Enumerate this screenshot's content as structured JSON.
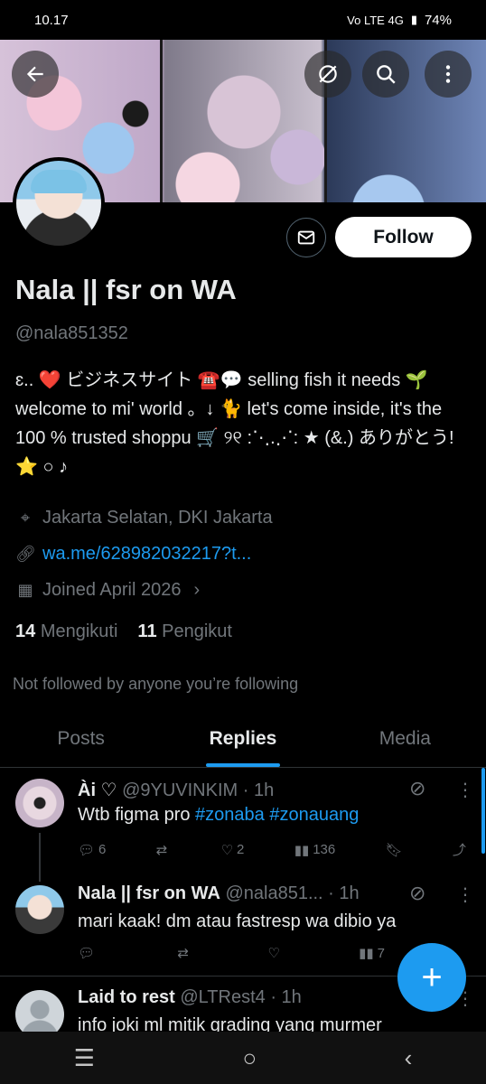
{
  "status_bar": {
    "time": "10.17",
    "icons": "  Vo LTE 4G",
    "battery": "74%"
  },
  "header": {
    "back_icon": "arrow-left-icon",
    "grok_icon": "grok-icon",
    "search_icon": "search-icon",
    "more_icon": "more-vertical-icon"
  },
  "profile": {
    "follow_label": "Follow",
    "name": "Nala || fsr on WA",
    "handle": "@nala851352",
    "bio": "ɛ.. ❤️ ビジネスサイト ☎️💬 selling fish it needs 🌱 welcome to mi' world 。↓ 🐈 let's come inside, it's the 100 % trusted shoppu 🛒 ୨୧ :⋱.⋰: ★ (&.) ありがとう!  ⭐ ○ ♪",
    "location": "Jakarta Selatan, DKI Jakarta",
    "link": "wa.me/628982032217?t...",
    "joined": "Joined April 2026",
    "following_count": "14",
    "following_label": "Mengikuti",
    "followers_count": "11",
    "followers_label": "Pengikut",
    "not_followed": "Not followed by anyone you’re following"
  },
  "tabs": [
    {
      "label": "Posts"
    },
    {
      "label": "Replies"
    },
    {
      "label": "Media"
    }
  ],
  "tweets": [
    {
      "name": "Ài ♡",
      "handle": "@9YUVINKIM",
      "time": "· 1h",
      "text_plain": "Wtb figma pro ",
      "tag1": "#zonaba",
      "tag2": "#zonauang",
      "replies": "6",
      "reposts": "",
      "likes": "2",
      "views": "136"
    },
    {
      "name": "Nala || fsr on WA",
      "handle": "@nala851...",
      "time": "· 1h",
      "text_plain": "mari kaak! dm atau fastresp wa dibio ya",
      "replies": "",
      "reposts": "",
      "likes": "",
      "views": "7"
    },
    {
      "name": "Laid to rest",
      "handle": "@LTRest4",
      "time": "· 1h",
      "text_plain": "info joki ml mitik grading yang murmer"
    }
  ],
  "fab_label": "+"
}
